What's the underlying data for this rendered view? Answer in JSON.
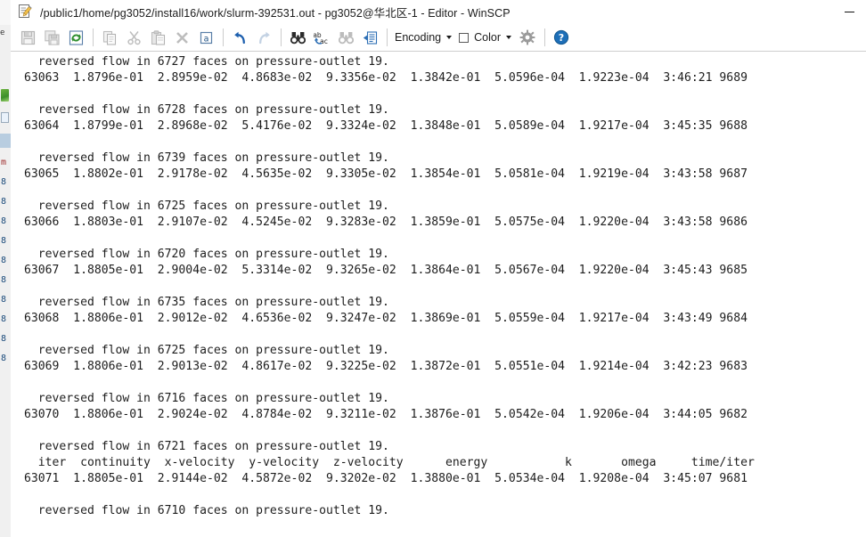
{
  "window": {
    "title": "/public1/home/pg3052/install16/work/slurm-392531.out - pg3052@华北区-1 - Editor - WinSCP",
    "app_icon": "edit-document-icon",
    "minimize_label": "—"
  },
  "toolbar": {
    "items": [
      {
        "name": "save-button",
        "icon": "floppy-disk-icon",
        "label": "Save",
        "enabled": false
      },
      {
        "name": "save-as-button",
        "icon": "save-copy-icon",
        "label": "Save As",
        "enabled": false
      },
      {
        "name": "reload-button",
        "icon": "reload-arrows-icon",
        "label": "Reload",
        "enabled": true
      },
      {
        "name": "copy-button",
        "icon": "copy-pages-icon",
        "label": "Copy",
        "enabled": false
      },
      {
        "name": "cut-button",
        "icon": "scissors-icon",
        "label": "Cut",
        "enabled": false
      },
      {
        "name": "paste-button",
        "icon": "clipboard-icon",
        "label": "Paste",
        "enabled": false
      },
      {
        "name": "delete-button",
        "icon": "x-cross-icon",
        "label": "Delete",
        "enabled": false
      },
      {
        "name": "select-all-button",
        "icon": "letter-a-box-icon",
        "label": "Select All",
        "enabled": false
      },
      {
        "name": "undo-button",
        "icon": "undo-arrow-icon",
        "label": "Undo",
        "enabled": true
      },
      {
        "name": "redo-button",
        "icon": "redo-arrow-icon",
        "label": "Redo",
        "enabled": false
      },
      {
        "name": "find-button",
        "icon": "binoculars-icon",
        "label": "Find",
        "enabled": true
      },
      {
        "name": "replace-button",
        "icon": "replace-ab-ac-icon",
        "label": "Replace",
        "enabled": true
      },
      {
        "name": "find-again-button",
        "icon": "binoculars-next-icon",
        "label": "Find Again",
        "enabled": false
      },
      {
        "name": "go-to-line-button",
        "icon": "go-to-line-icon",
        "label": "Go To Line",
        "enabled": true
      }
    ],
    "encoding_label": "Encoding",
    "color_label": "Color",
    "preferences_icon": "gear-icon",
    "preferences_label": "Preferences",
    "help_icon": "help-question-icon",
    "help_label": "Help"
  },
  "editor": {
    "filename": "slurm-392531.out",
    "content": "  reversed flow in 6727 faces on pressure-outlet 19.\n63063  1.8796e-01  2.8959e-02  4.8683e-02  9.3356e-02  1.3842e-01  5.0596e-04  1.9223e-04  3:46:21 9689\n\n  reversed flow in 6728 faces on pressure-outlet 19.\n63064  1.8799e-01  2.8968e-02  5.4176e-02  9.3324e-02  1.3848e-01  5.0589e-04  1.9217e-04  3:45:35 9688\n\n  reversed flow in 6739 faces on pressure-outlet 19.\n63065  1.8802e-01  2.9178e-02  4.5635e-02  9.3305e-02  1.3854e-01  5.0581e-04  1.9219e-04  3:43:58 9687\n\n  reversed flow in 6725 faces on pressure-outlet 19.\n63066  1.8803e-01  2.9107e-02  4.5245e-02  9.3283e-02  1.3859e-01  5.0575e-04  1.9220e-04  3:43:58 9686\n\n  reversed flow in 6720 faces on pressure-outlet 19.\n63067  1.8805e-01  2.9004e-02  5.3314e-02  9.3265e-02  1.3864e-01  5.0567e-04  1.9220e-04  3:45:43 9685\n\n  reversed flow in 6735 faces on pressure-outlet 19.\n63068  1.8806e-01  2.9012e-02  4.6536e-02  9.3247e-02  1.3869e-01  5.0559e-04  1.9217e-04  3:43:49 9684\n\n  reversed flow in 6725 faces on pressure-outlet 19.\n63069  1.8806e-01  2.9013e-02  4.8617e-02  9.3225e-02  1.3872e-01  5.0551e-04  1.9214e-04  3:42:23 9683\n\n  reversed flow in 6716 faces on pressure-outlet 19.\n63070  1.8806e-01  2.9024e-02  4.8784e-02  9.3211e-02  1.3876e-01  5.0542e-04  1.9206e-04  3:44:05 9682\n\n  reversed flow in 6721 faces on pressure-outlet 19.\n  iter  continuity  x-velocity  y-velocity  z-velocity      energy           k       omega     time/iter\n63071  1.8805e-01  2.9144e-02  4.5872e-02  9.3202e-02  1.3880e-01  5.0534e-04  1.9208e-04  3:45:07 9681\n\n  reversed flow in 6710 faces on pressure-outlet 19.",
    "columns": [
      "iter",
      "continuity",
      "x-velocity",
      "y-velocity",
      "z-velocity",
      "energy",
      "k",
      "omega",
      "time/iter"
    ],
    "rows": [
      {
        "iter": "63063",
        "continuity": "1.8796e-01",
        "x-velocity": "2.8959e-02",
        "y-velocity": "4.8683e-02",
        "z-velocity": "9.3356e-02",
        "energy": "1.3842e-01",
        "k": "5.0596e-04",
        "omega": "1.9223e-04",
        "time": "3:46:21",
        "iters_left": "9689",
        "reversed_flow_faces": "6727"
      },
      {
        "iter": "63064",
        "continuity": "1.8799e-01",
        "x-velocity": "2.8968e-02",
        "y-velocity": "5.4176e-02",
        "z-velocity": "9.3324e-02",
        "energy": "1.3848e-01",
        "k": "5.0589e-04",
        "omega": "1.9217e-04",
        "time": "3:45:35",
        "iters_left": "9688",
        "reversed_flow_faces": "6728"
      },
      {
        "iter": "63065",
        "continuity": "1.8802e-01",
        "x-velocity": "2.9178e-02",
        "y-velocity": "4.5635e-02",
        "z-velocity": "9.3305e-02",
        "energy": "1.3854e-01",
        "k": "5.0581e-04",
        "omega": "1.9219e-04",
        "time": "3:43:58",
        "iters_left": "9687",
        "reversed_flow_faces": "6739"
      },
      {
        "iter": "63066",
        "continuity": "1.8803e-01",
        "x-velocity": "2.9107e-02",
        "y-velocity": "4.5245e-02",
        "z-velocity": "9.3283e-02",
        "energy": "1.3859e-01",
        "k": "5.0575e-04",
        "omega": "1.9220e-04",
        "time": "3:43:58",
        "iters_left": "9686",
        "reversed_flow_faces": "6725"
      },
      {
        "iter": "63067",
        "continuity": "1.8805e-01",
        "x-velocity": "2.9004e-02",
        "y-velocity": "5.3314e-02",
        "z-velocity": "9.3265e-02",
        "energy": "1.3864e-01",
        "k": "5.0567e-04",
        "omega": "1.9220e-04",
        "time": "3:45:43",
        "iters_left": "9685",
        "reversed_flow_faces": "6720"
      },
      {
        "iter": "63068",
        "continuity": "1.8806e-01",
        "x-velocity": "2.9012e-02",
        "y-velocity": "4.6536e-02",
        "z-velocity": "9.3247e-02",
        "energy": "1.3869e-01",
        "k": "5.0559e-04",
        "omega": "1.9217e-04",
        "time": "3:43:49",
        "iters_left": "9684",
        "reversed_flow_faces": "6735"
      },
      {
        "iter": "63069",
        "continuity": "1.8806e-01",
        "x-velocity": "2.9013e-02",
        "y-velocity": "4.8617e-02",
        "z-velocity": "9.3225e-02",
        "energy": "1.3872e-01",
        "k": "5.0551e-04",
        "omega": "1.9214e-04",
        "time": "3:42:23",
        "iters_left": "9683",
        "reversed_flow_faces": "6725"
      },
      {
        "iter": "63070",
        "continuity": "1.8806e-01",
        "x-velocity": "2.9024e-02",
        "y-velocity": "4.8784e-02",
        "z-velocity": "9.3211e-02",
        "energy": "1.3876e-01",
        "k": "5.0542e-04",
        "omega": "1.9206e-04",
        "time": "3:44:05",
        "iters_left": "9682",
        "reversed_flow_faces": "6716"
      },
      {
        "iter": "63071",
        "continuity": "1.8805e-01",
        "x-velocity": "2.9144e-02",
        "y-velocity": "4.5872e-02",
        "z-velocity": "9.3202e-02",
        "energy": "1.3880e-01",
        "k": "5.0534e-04",
        "omega": "1.9208e-04",
        "time": "3:45:07",
        "iters_left": "9681",
        "reversed_flow_faces": "6721"
      }
    ],
    "trailing_message_faces": "6710"
  },
  "background_window": {
    "fragments": [
      "e",
      "m",
      "8",
      "8",
      "8",
      "8",
      "8",
      "8",
      "8",
      "8",
      "8",
      "8"
    ]
  },
  "colors": {
    "window_bg": "#ffffff",
    "toolbar_border": "#cfcfcf",
    "text": "#1d1d1d",
    "accent_blue": "#1d6fb8",
    "icon_disabled": "#b0b0b0",
    "green": "#4c9a2a"
  }
}
